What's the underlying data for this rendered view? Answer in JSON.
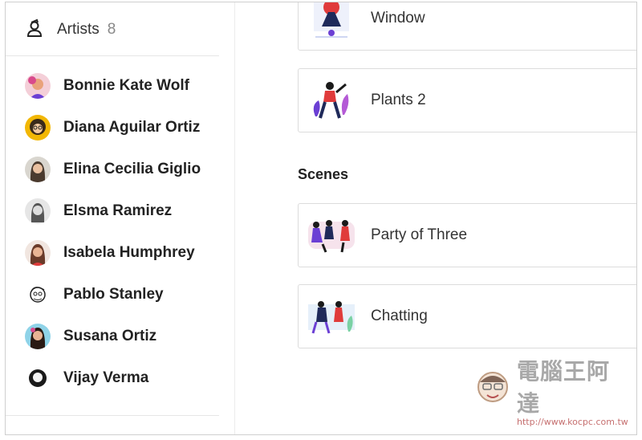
{
  "sidebar": {
    "header": {
      "label": "Artists",
      "count": "8"
    },
    "artists": [
      {
        "name": "Bonnie Kate Wolf"
      },
      {
        "name": "Diana Aguilar Ortiz"
      },
      {
        "name": "Elina Cecilia Giglio"
      },
      {
        "name": "Elsma Ramirez"
      },
      {
        "name": "Isabela Humphrey"
      },
      {
        "name": "Pablo Stanley"
      },
      {
        "name": "Susana Ortiz"
      },
      {
        "name": "Vijay Verma"
      }
    ]
  },
  "main": {
    "cards_top": [
      {
        "label": "Window"
      },
      {
        "label": "Plants 2"
      }
    ],
    "scenes": {
      "title": "Scenes",
      "items": [
        {
          "label": "Party of Three"
        },
        {
          "label": "Chatting"
        }
      ]
    }
  },
  "watermark": {
    "title": "電腦王阿達",
    "url": "http://www.kocpc.com.tw"
  },
  "colors": {
    "accent_red": "#e03b3b",
    "navy": "#1f2a5a",
    "purple": "#6b3fd4",
    "pink": "#d94a8c",
    "yellow": "#f2b705"
  }
}
